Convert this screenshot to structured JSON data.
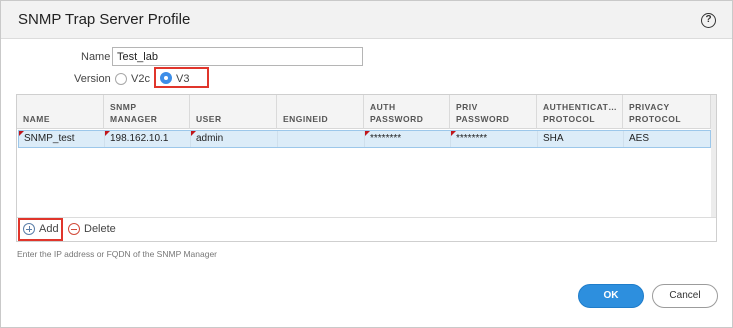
{
  "dialog": {
    "title": "SNMP Trap Server Profile",
    "help_icon": "?"
  },
  "form": {
    "name_label": "Name",
    "name_value": "Test_lab",
    "version_label": "Version",
    "version_options": [
      {
        "label": "V2c",
        "selected": false
      },
      {
        "label": "V3",
        "selected": true
      }
    ]
  },
  "grid": {
    "columns": [
      {
        "l1": "NAME",
        "l2": ""
      },
      {
        "l1": "SNMP",
        "l2": "MANAGER"
      },
      {
        "l1": "USER",
        "l2": ""
      },
      {
        "l1": "ENGINEID",
        "l2": ""
      },
      {
        "l1": "AUTH",
        "l2": "PASSWORD"
      },
      {
        "l1": "PRIV",
        "l2": "PASSWORD"
      },
      {
        "l1": "AUTHENTICAT…",
        "l2": "PROTOCOL"
      },
      {
        "l1": "PRIVACY",
        "l2": "PROTOCOL"
      }
    ],
    "rows": [
      [
        "SNMP_test",
        "198.162.10.1",
        "admin",
        "",
        "********",
        "********",
        "SHA",
        "AES"
      ]
    ],
    "add_label": "Add",
    "delete_label": "Delete"
  },
  "hint": "Enter the IP address or FQDN of the SNMP Manager",
  "buttons": {
    "ok": "OK",
    "cancel": "Cancel"
  },
  "colors": {
    "accent": "#2d8fde",
    "highlight_box": "#e0352b",
    "selected_row": "#dcecf8"
  }
}
